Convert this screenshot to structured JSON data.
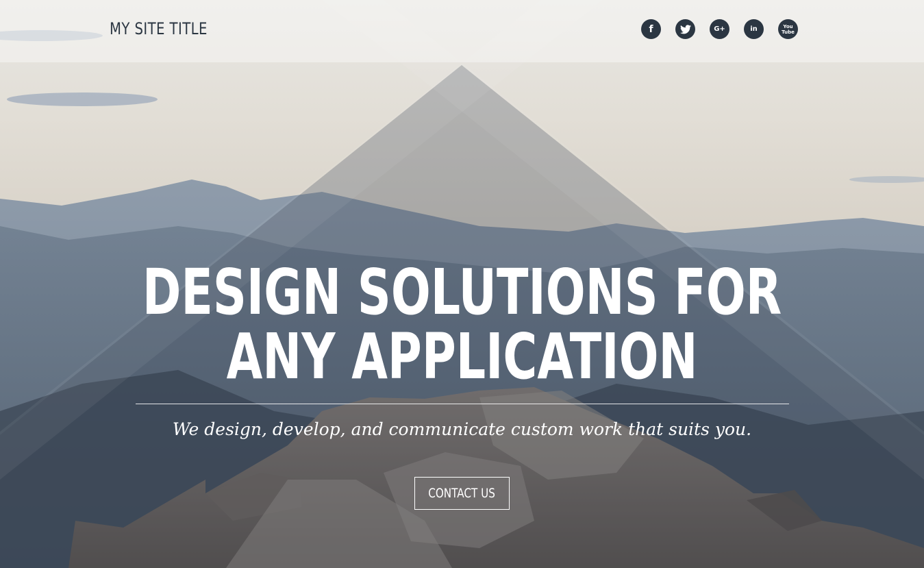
{
  "header": {
    "site_title": "MY SITE TITLE",
    "social": [
      {
        "name": "facebook-icon",
        "glyph": "f"
      },
      {
        "name": "twitter-icon",
        "glyph": "t"
      },
      {
        "name": "google-plus-icon",
        "glyph": "G+"
      },
      {
        "name": "linkedin-icon",
        "glyph": "in"
      },
      {
        "name": "youtube-icon",
        "glyph": "You Tube"
      }
    ]
  },
  "hero": {
    "headline_line1": "DESIGN SOLUTIONS FOR",
    "headline_line2": "ANY APPLICATION",
    "tagline": "We design, develop, and communicate custom work that suits you.",
    "cta_label": "CONTACT US"
  },
  "colors": {
    "header_text": "#2b3642",
    "icon_bg": "#2b3642",
    "hero_text": "#ffffff"
  }
}
